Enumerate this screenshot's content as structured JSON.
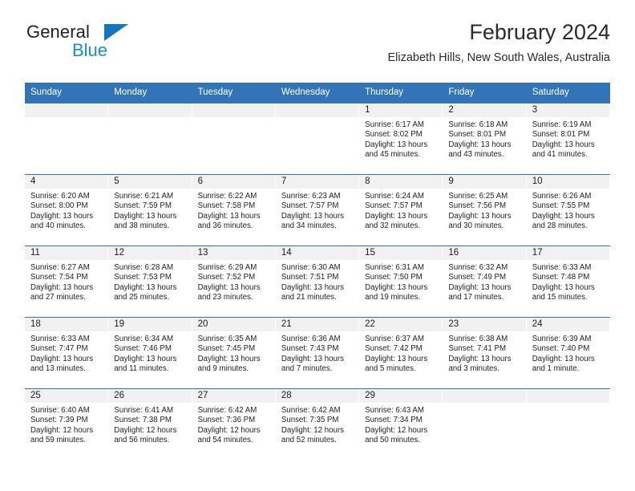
{
  "brand": {
    "name_part1": "General",
    "name_part2": "Blue",
    "logo_icon": "triangle-logo-icon",
    "color_dark": "#222222",
    "color_blue": "#1b8bd0"
  },
  "header": {
    "title": "February 2024",
    "subtitle": "Elizabeth Hills, New South Wales, Australia"
  },
  "theme": {
    "header_blue": "#3274b8",
    "day_band_gray": "#f1f1f1",
    "text": "#232323"
  },
  "calendar": {
    "weekday_headers": [
      "Sunday",
      "Monday",
      "Tuesday",
      "Wednesday",
      "Thursday",
      "Friday",
      "Saturday"
    ],
    "weeks": [
      [
        {
          "day": "",
          "sunrise": "",
          "sunset": "",
          "daylight_line1": "",
          "daylight_line2": ""
        },
        {
          "day": "",
          "sunrise": "",
          "sunset": "",
          "daylight_line1": "",
          "daylight_line2": ""
        },
        {
          "day": "",
          "sunrise": "",
          "sunset": "",
          "daylight_line1": "",
          "daylight_line2": ""
        },
        {
          "day": "",
          "sunrise": "",
          "sunset": "",
          "daylight_line1": "",
          "daylight_line2": ""
        },
        {
          "day": "1",
          "sunrise": "Sunrise: 6:17 AM",
          "sunset": "Sunset: 8:02 PM",
          "daylight_line1": "Daylight: 13 hours",
          "daylight_line2": "and 45 minutes."
        },
        {
          "day": "2",
          "sunrise": "Sunrise: 6:18 AM",
          "sunset": "Sunset: 8:01 PM",
          "daylight_line1": "Daylight: 13 hours",
          "daylight_line2": "and 43 minutes."
        },
        {
          "day": "3",
          "sunrise": "Sunrise: 6:19 AM",
          "sunset": "Sunset: 8:01 PM",
          "daylight_line1": "Daylight: 13 hours",
          "daylight_line2": "and 41 minutes."
        }
      ],
      [
        {
          "day": "4",
          "sunrise": "Sunrise: 6:20 AM",
          "sunset": "Sunset: 8:00 PM",
          "daylight_line1": "Daylight: 13 hours",
          "daylight_line2": "and 40 minutes."
        },
        {
          "day": "5",
          "sunrise": "Sunrise: 6:21 AM",
          "sunset": "Sunset: 7:59 PM",
          "daylight_line1": "Daylight: 13 hours",
          "daylight_line2": "and 38 minutes."
        },
        {
          "day": "6",
          "sunrise": "Sunrise: 6:22 AM",
          "sunset": "Sunset: 7:58 PM",
          "daylight_line1": "Daylight: 13 hours",
          "daylight_line2": "and 36 minutes."
        },
        {
          "day": "7",
          "sunrise": "Sunrise: 6:23 AM",
          "sunset": "Sunset: 7:57 PM",
          "daylight_line1": "Daylight: 13 hours",
          "daylight_line2": "and 34 minutes."
        },
        {
          "day": "8",
          "sunrise": "Sunrise: 6:24 AM",
          "sunset": "Sunset: 7:57 PM",
          "daylight_line1": "Daylight: 13 hours",
          "daylight_line2": "and 32 minutes."
        },
        {
          "day": "9",
          "sunrise": "Sunrise: 6:25 AM",
          "sunset": "Sunset: 7:56 PM",
          "daylight_line1": "Daylight: 13 hours",
          "daylight_line2": "and 30 minutes."
        },
        {
          "day": "10",
          "sunrise": "Sunrise: 6:26 AM",
          "sunset": "Sunset: 7:55 PM",
          "daylight_line1": "Daylight: 13 hours",
          "daylight_line2": "and 28 minutes."
        }
      ],
      [
        {
          "day": "11",
          "sunrise": "Sunrise: 6:27 AM",
          "sunset": "Sunset: 7:54 PM",
          "daylight_line1": "Daylight: 13 hours",
          "daylight_line2": "and 27 minutes."
        },
        {
          "day": "12",
          "sunrise": "Sunrise: 6:28 AM",
          "sunset": "Sunset: 7:53 PM",
          "daylight_line1": "Daylight: 13 hours",
          "daylight_line2": "and 25 minutes."
        },
        {
          "day": "13",
          "sunrise": "Sunrise: 6:29 AM",
          "sunset": "Sunset: 7:52 PM",
          "daylight_line1": "Daylight: 13 hours",
          "daylight_line2": "and 23 minutes."
        },
        {
          "day": "14",
          "sunrise": "Sunrise: 6:30 AM",
          "sunset": "Sunset: 7:51 PM",
          "daylight_line1": "Daylight: 13 hours",
          "daylight_line2": "and 21 minutes."
        },
        {
          "day": "15",
          "sunrise": "Sunrise: 6:31 AM",
          "sunset": "Sunset: 7:50 PM",
          "daylight_line1": "Daylight: 13 hours",
          "daylight_line2": "and 19 minutes."
        },
        {
          "day": "16",
          "sunrise": "Sunrise: 6:32 AM",
          "sunset": "Sunset: 7:49 PM",
          "daylight_line1": "Daylight: 13 hours",
          "daylight_line2": "and 17 minutes."
        },
        {
          "day": "17",
          "sunrise": "Sunrise: 6:33 AM",
          "sunset": "Sunset: 7:48 PM",
          "daylight_line1": "Daylight: 13 hours",
          "daylight_line2": "and 15 minutes."
        }
      ],
      [
        {
          "day": "18",
          "sunrise": "Sunrise: 6:33 AM",
          "sunset": "Sunset: 7:47 PM",
          "daylight_line1": "Daylight: 13 hours",
          "daylight_line2": "and 13 minutes."
        },
        {
          "day": "19",
          "sunrise": "Sunrise: 6:34 AM",
          "sunset": "Sunset: 7:46 PM",
          "daylight_line1": "Daylight: 13 hours",
          "daylight_line2": "and 11 minutes."
        },
        {
          "day": "20",
          "sunrise": "Sunrise: 6:35 AM",
          "sunset": "Sunset: 7:45 PM",
          "daylight_line1": "Daylight: 13 hours",
          "daylight_line2": "and 9 minutes."
        },
        {
          "day": "21",
          "sunrise": "Sunrise: 6:36 AM",
          "sunset": "Sunset: 7:43 PM",
          "daylight_line1": "Daylight: 13 hours",
          "daylight_line2": "and 7 minutes."
        },
        {
          "day": "22",
          "sunrise": "Sunrise: 6:37 AM",
          "sunset": "Sunset: 7:42 PM",
          "daylight_line1": "Daylight: 13 hours",
          "daylight_line2": "and 5 minutes."
        },
        {
          "day": "23",
          "sunrise": "Sunrise: 6:38 AM",
          "sunset": "Sunset: 7:41 PM",
          "daylight_line1": "Daylight: 13 hours",
          "daylight_line2": "and 3 minutes."
        },
        {
          "day": "24",
          "sunrise": "Sunrise: 6:39 AM",
          "sunset": "Sunset: 7:40 PM",
          "daylight_line1": "Daylight: 13 hours",
          "daylight_line2": "and 1 minute."
        }
      ],
      [
        {
          "day": "25",
          "sunrise": "Sunrise: 6:40 AM",
          "sunset": "Sunset: 7:39 PM",
          "daylight_line1": "Daylight: 12 hours",
          "daylight_line2": "and 59 minutes."
        },
        {
          "day": "26",
          "sunrise": "Sunrise: 6:41 AM",
          "sunset": "Sunset: 7:38 PM",
          "daylight_line1": "Daylight: 12 hours",
          "daylight_line2": "and 56 minutes."
        },
        {
          "day": "27",
          "sunrise": "Sunrise: 6:42 AM",
          "sunset": "Sunset: 7:36 PM",
          "daylight_line1": "Daylight: 12 hours",
          "daylight_line2": "and 54 minutes."
        },
        {
          "day": "28",
          "sunrise": "Sunrise: 6:42 AM",
          "sunset": "Sunset: 7:35 PM",
          "daylight_line1": "Daylight: 12 hours",
          "daylight_line2": "and 52 minutes."
        },
        {
          "day": "29",
          "sunrise": "Sunrise: 6:43 AM",
          "sunset": "Sunset: 7:34 PM",
          "daylight_line1": "Daylight: 12 hours",
          "daylight_line2": "and 50 minutes."
        },
        {
          "day": "",
          "sunrise": "",
          "sunset": "",
          "daylight_line1": "",
          "daylight_line2": ""
        },
        {
          "day": "",
          "sunrise": "",
          "sunset": "",
          "daylight_line1": "",
          "daylight_line2": ""
        }
      ]
    ]
  }
}
